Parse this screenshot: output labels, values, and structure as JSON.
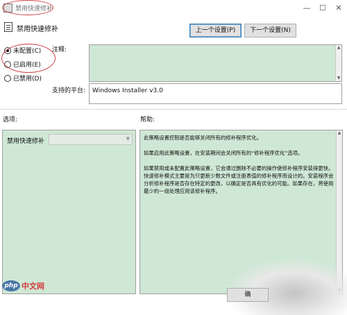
{
  "window": {
    "title": "禁用快速修补",
    "minimize_glyph": "—",
    "maximize_glyph": "☐",
    "close_glyph": "✕"
  },
  "header": {
    "policy_name": "禁用快速修补",
    "prev_button": "上一个设置(P)",
    "next_button": "下一个设置(N)"
  },
  "state": {
    "options": [
      {
        "label": "未配置(C)",
        "selected": true
      },
      {
        "label": "已启用(E)",
        "selected": false
      },
      {
        "label": "已禁用(D)",
        "selected": false
      }
    ]
  },
  "comment": {
    "label": "注释:",
    "value": ""
  },
  "platform": {
    "label": "支持的平台:",
    "value": "Windows Installer v3.0"
  },
  "sections": {
    "options_label": "选项:",
    "help_label": "帮助:"
  },
  "options_panel": {
    "item_label": "禁用快速修补",
    "item_value": ""
  },
  "help": {
    "paragraphs": [
      "此策略设置控制是否能够关闭所有的修补程序优化。",
      "如果启用此策略设置，在安装期间会关闭所有的“修补程序优化”选项。",
      "如果禁用或未配置此策略设置，它会通过删除不必要的操作使修补程序安装得更快。快速修补模式主要是为只更新少数文件或注册表值的修补程序而设计的。安装程序会分析修补程序是否存在特定的更改，以确定是否具有优化的可能。如果存在，将使用最少的一组处理应用该修补程序。"
    ]
  },
  "footer": {
    "logo_badge": "php",
    "logo_text": "中文网",
    "partial_button": "确"
  },
  "colors": {
    "panel_green": "#cfe8d5",
    "annotation_red": "#d04040"
  }
}
